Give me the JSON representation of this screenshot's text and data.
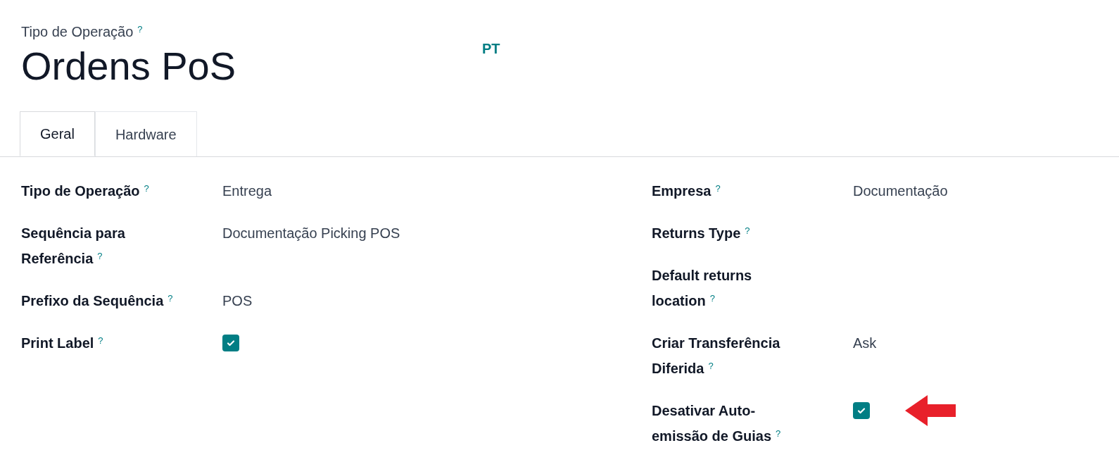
{
  "header": {
    "label": "Tipo de Operação",
    "help": "?",
    "title": "Ordens PoS",
    "language": "PT"
  },
  "tabs": [
    {
      "label": "Geral",
      "selected": true
    },
    {
      "label": "Hardware",
      "selected": false
    }
  ],
  "left_fields": [
    {
      "label": "Tipo de Operação",
      "help": "?",
      "kind": "text",
      "value": "Entrega"
    },
    {
      "label": "Sequência para Referência",
      "help": "?",
      "kind": "text",
      "value": "Documentação Picking POS"
    },
    {
      "label": "Prefixo da Sequência",
      "help": "?",
      "kind": "text",
      "value": "POS"
    },
    {
      "label": "Print Label",
      "help": "?",
      "kind": "checkbox",
      "checked": true
    }
  ],
  "right_fields": [
    {
      "label": "Empresa",
      "help": "?",
      "kind": "text",
      "value": "Documentação"
    },
    {
      "label": "Returns Type",
      "help": "?",
      "kind": "empty"
    },
    {
      "label": "Default returns location",
      "help": "?",
      "kind": "empty"
    },
    {
      "label": "Criar Transferência Diferida",
      "help": "?",
      "kind": "text",
      "value": "Ask"
    },
    {
      "label": "Desativar Auto-emissão de Guias",
      "help": "?",
      "kind": "checkbox",
      "checked": true,
      "annotated": true
    }
  ]
}
